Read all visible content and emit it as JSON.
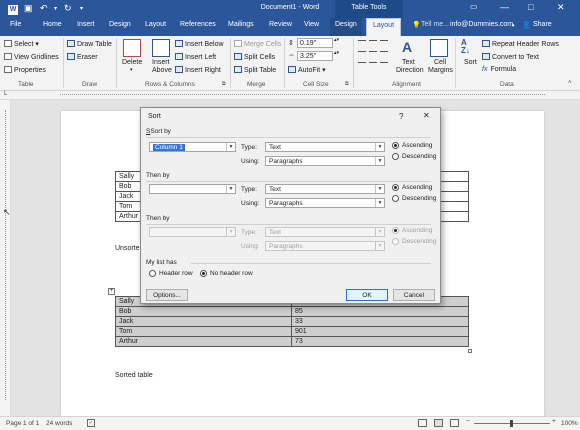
{
  "window": {
    "title": "Document1 - Word",
    "tool_title": "Table Tools",
    "minimize": "—",
    "maximize": "□",
    "close": "✕"
  },
  "tabs": [
    {
      "label": "File"
    },
    {
      "label": "Home"
    },
    {
      "label": "Insert"
    },
    {
      "label": "Design"
    },
    {
      "label": "Layout"
    },
    {
      "label": "References"
    },
    {
      "label": "Mailings"
    },
    {
      "label": "Review"
    },
    {
      "label": "View"
    },
    {
      "label": "Design"
    },
    {
      "label": "Layout"
    }
  ],
  "tell_me": "Tell me...",
  "account": "info@Dummies.com",
  "share": "Share",
  "ribbon": {
    "select": "Select",
    "view_gridlines": "View Gridlines",
    "properties": "Properties",
    "group_table": "Table",
    "draw_table": "Draw Table",
    "eraser": "Eraser",
    "group_draw": "Draw",
    "delete": "Delete",
    "insert_above_1": "Insert",
    "insert_above_2": "Above",
    "insert_below": "Insert Below",
    "insert_left": "Insert Left",
    "insert_right": "Insert Right",
    "group_rows_columns": "Rows & Columns",
    "merge_cells": "Merge Cells",
    "split_cells": "Split Cells",
    "split_table": "Split Table",
    "group_merge": "Merge",
    "height_value": "0.19\"",
    "width_value": "3.25\"",
    "autofit": "AutoFit",
    "group_cell_size": "Cell Size",
    "text_direction_1": "Text",
    "text_direction_2": "Direction",
    "cell_margins_1": "Cell",
    "cell_margins_2": "Margins",
    "group_alignment": "Alignment",
    "sort": "Sort",
    "repeat_header_rows": "Repeat Header Rows",
    "convert_to_text": "Convert to Text",
    "formula": "Formula",
    "group_data": "Data"
  },
  "document": {
    "unsorted_label": "Unsorted table",
    "unsorted_visible_label": "Unsorte",
    "sorted_label": "Sorted table",
    "table1_names": [
      "Sally",
      "Bob",
      "Jack",
      "Tom",
      "Arthur"
    ],
    "table2_rows": [
      {
        "name": "Sally",
        "value": ""
      },
      {
        "name": "Bob",
        "value": "85"
      },
      {
        "name": "Jack",
        "value": "33"
      },
      {
        "name": "Tom",
        "value": "901"
      },
      {
        "name": "Arthur",
        "value": "73"
      }
    ]
  },
  "status": {
    "page": "Page 1 of 1",
    "words": "24 words",
    "zoom": "100%"
  },
  "dialog": {
    "title": "Sort",
    "help": "?",
    "close": "✕",
    "sort_by_label": "Sort by",
    "sort_by_value": "Column 1",
    "type_label": "Type:",
    "using_label": "Using:",
    "type1_value": "Text",
    "using1_value": "Paragraphs",
    "ascending": "Ascending",
    "descending": "Descending",
    "then_by_label": "Then by",
    "then_by1_value": "",
    "type2_value": "Text",
    "using2_value": "Paragraphs",
    "then_by2_label": "Then by",
    "type3_value": "Text",
    "using3_value": "Paragraphs",
    "my_list_has": "My list has",
    "header_row": "Header row",
    "no_header_row": "No header row",
    "options": "Options...",
    "ok": "OK",
    "cancel": "Cancel"
  },
  "colors": {
    "word_blue": "#2b579a",
    "selection": "#3874d8"
  }
}
